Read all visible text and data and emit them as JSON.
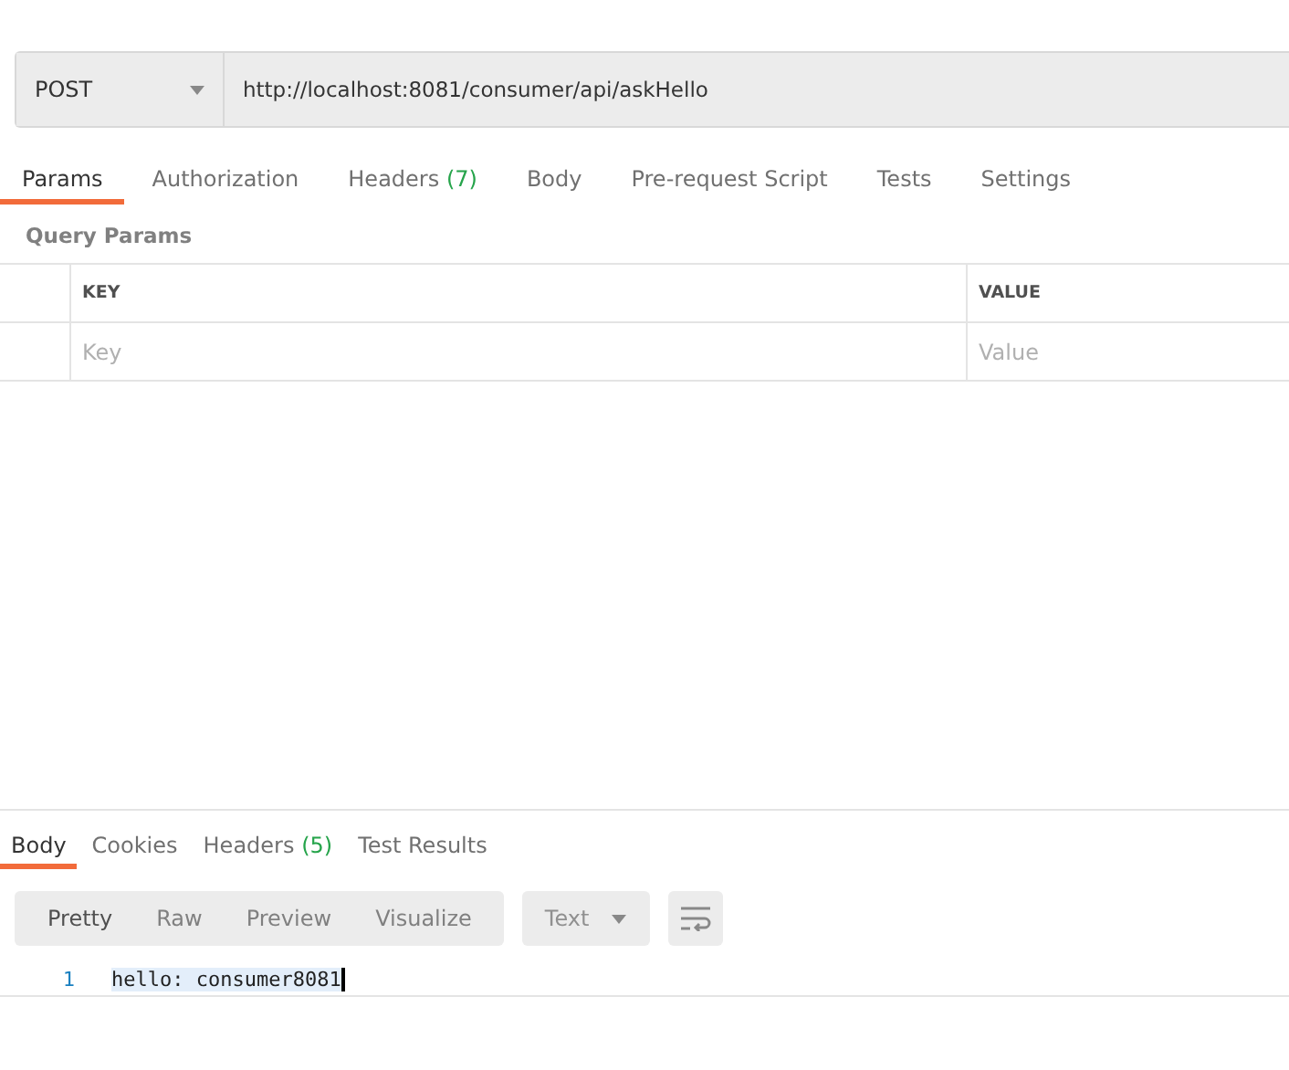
{
  "request": {
    "method": "POST",
    "url": "http://localhost:8081/consumer/api/askHello"
  },
  "tabs": [
    {
      "label": "Params",
      "selected": true
    },
    {
      "label": "Authorization",
      "selected": false
    },
    {
      "label": "Headers",
      "count": "(7)",
      "selected": false
    },
    {
      "label": "Body",
      "selected": false
    },
    {
      "label": "Pre-request Script",
      "selected": false
    },
    {
      "label": "Tests",
      "selected": false
    },
    {
      "label": "Settings",
      "selected": false
    }
  ],
  "query_params": {
    "title": "Query Params",
    "columns": [
      "KEY",
      "VALUE"
    ],
    "placeholders": [
      "Key",
      "Value"
    ]
  },
  "response": {
    "tabs": [
      {
        "label": "Body",
        "selected": true
      },
      {
        "label": "Cookies",
        "selected": false
      },
      {
        "label": "Headers",
        "count": "(5)",
        "selected": false
      },
      {
        "label": "Test Results",
        "selected": false
      }
    ],
    "views": [
      {
        "label": "Pretty",
        "selected": true
      },
      {
        "label": "Raw",
        "selected": false
      },
      {
        "label": "Preview",
        "selected": false
      },
      {
        "label": "Visualize",
        "selected": false
      }
    ],
    "format": "Text",
    "lines": [
      {
        "number": "1",
        "text": "hello: consumer8081"
      }
    ]
  }
}
